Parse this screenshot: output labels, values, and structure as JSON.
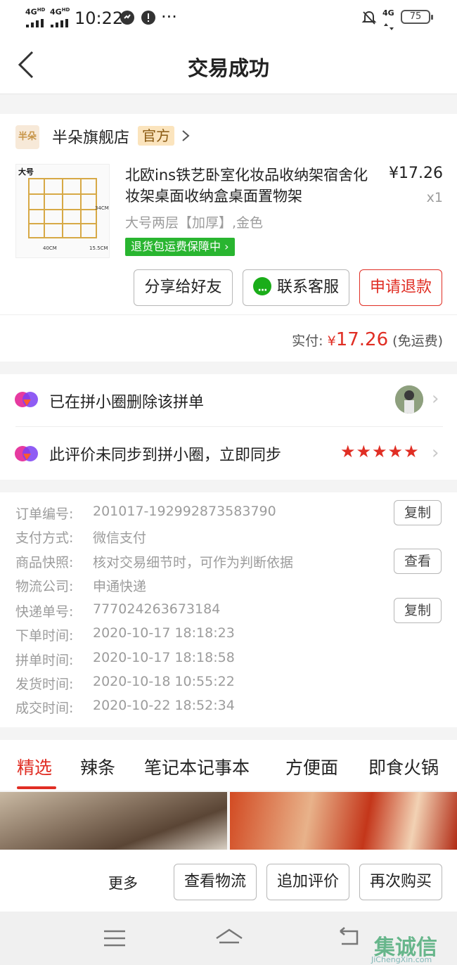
{
  "status_bar": {
    "network1": "4G",
    "network1_hd": "HD",
    "network2": "4G",
    "network2_hd": "HD",
    "time": "10:22",
    "more": "···",
    "net_right": "4G",
    "battery": "75"
  },
  "header": {
    "title": "交易成功"
  },
  "store": {
    "logo_text": "半朵",
    "name": "半朵旗舰店",
    "badge": "官方"
  },
  "product": {
    "thumb_tag": "大号",
    "thumb_dim1": "34CM",
    "thumb_dim2": "40CM",
    "thumb_dim3": "15.5CM",
    "title": "北欧ins铁艺卧室化妆品收纳架宿舍化妆架桌面收纳盒桌面置物架",
    "price": "¥17.26",
    "qty": "x1",
    "spec": "大号两层【加厚】,金色",
    "guarantee": "退货包运费保障中"
  },
  "actions": {
    "share": "分享给好友",
    "service": "联系客服",
    "refund": "申请退款"
  },
  "payment": {
    "label": "实付:",
    "yen": "¥",
    "amount": "17.26",
    "note": "(免运费)"
  },
  "social": {
    "row1": "已在拼小圈删除该拼单",
    "row2": "此评价未同步到拼小圈，立即同步",
    "stars": "★★★★★",
    "rating": 5
  },
  "order_info": [
    {
      "label": "订单编号:",
      "value": "201017-192992873583790",
      "button": "复制"
    },
    {
      "label": "支付方式:",
      "value": "微信支付"
    },
    {
      "label": "商品快照:",
      "value": "核对交易细节时，可作为判断依据",
      "button": "查看"
    },
    {
      "label": "物流公司:",
      "value": "申通快递"
    },
    {
      "label": "快递单号:",
      "value": "777024263673184",
      "button": "复制"
    },
    {
      "label": "下单时间:",
      "value": "2020-10-17 18:18:23"
    },
    {
      "label": "拼单时间:",
      "value": "2020-10-17 18:18:58"
    },
    {
      "label": "发货时间:",
      "value": "2020-10-18 10:55:22"
    },
    {
      "label": "成交时间:",
      "value": "2020-10-22 18:52:34"
    }
  ],
  "tabs": [
    "精选",
    "辣条",
    "笔记本记事本",
    "方便面",
    "即食火锅"
  ],
  "bottom": {
    "more": "更多",
    "logistics": "查看物流",
    "review": "追加评价",
    "rebuy": "再次购买"
  },
  "watermark": {
    "main": "集诚信",
    "sub": "JiChengXin.com"
  },
  "colors": {
    "accent": "#e02e24",
    "green": "#29b530",
    "wechat": "#1aad19"
  }
}
